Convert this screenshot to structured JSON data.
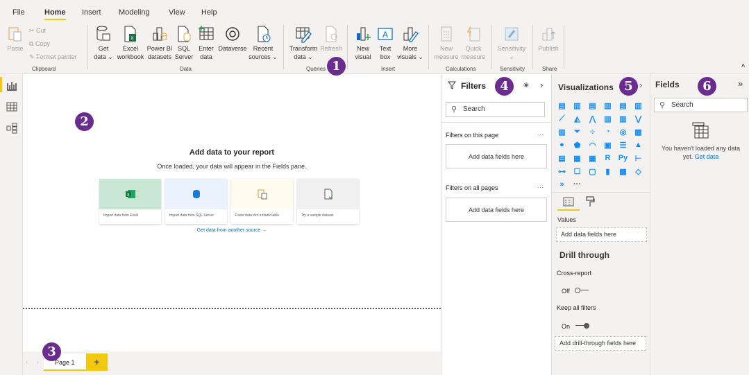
{
  "menu": {
    "tabs": [
      "File",
      "Home",
      "Insert",
      "Modeling",
      "View",
      "Help"
    ],
    "active": "Home"
  },
  "ribbon": {
    "clipboard": {
      "paste": "Paste",
      "cut": "Cut",
      "copy": "Copy",
      "format_painter": "Format painter",
      "group": "Clipboard"
    },
    "data": {
      "get_data": [
        "Get",
        "data ⌄"
      ],
      "excel": [
        "Excel",
        "workbook"
      ],
      "powerbi": [
        "Power BI",
        "datasets"
      ],
      "sql": [
        "SQL",
        "Server"
      ],
      "enter": [
        "Enter",
        "data"
      ],
      "dataverse": [
        "Dataverse",
        ""
      ],
      "recent": [
        "Recent",
        "sources ⌄"
      ],
      "group": "Data"
    },
    "queries": {
      "transform": [
        "Transform",
        "data ⌄"
      ],
      "refresh": [
        "Refresh",
        ""
      ],
      "group": "Queries"
    },
    "insert": {
      "new_visual": [
        "New",
        "visual"
      ],
      "text_box": [
        "Text",
        "box"
      ],
      "more_visuals": [
        "More",
        "visuals ⌄"
      ],
      "group": "Insert"
    },
    "calculations": {
      "new_measure": [
        "New",
        "measure"
      ],
      "quick_measure": [
        "Quick",
        "measure"
      ],
      "group": "Calculations"
    },
    "sensitivity": {
      "label": [
        "Sensitivity",
        "⌄"
      ],
      "group": "Sensitivity"
    },
    "share": {
      "publish": [
        "Publish",
        ""
      ],
      "group": "Share"
    },
    "collapse_icon": "^"
  },
  "badges": [
    "1",
    "2",
    "3",
    "4",
    "5",
    "6"
  ],
  "canvas": {
    "title": "Add data to your report",
    "subtitle": "Once loaded, your data will appear in the Fields pane.",
    "cards": [
      {
        "label": "Import data from Excel",
        "bg": "#c8e6d3"
      },
      {
        "label": "Import data from SQL Server",
        "bg": "#eaf2fc"
      },
      {
        "label": "Paste data into a blank table",
        "bg": "#fffbee"
      },
      {
        "label": "Try a sample dataset",
        "bg": "#f0f0f0"
      }
    ],
    "link": "Get data from another source →"
  },
  "pages": {
    "tabs": [
      "Page 1"
    ],
    "add": "+"
  },
  "filters": {
    "title": "Filters",
    "search_placeholder": "Search",
    "on_this_page": "Filters on this page",
    "on_all_pages": "Filters on all pages",
    "add_fields": "Add data fields here",
    "more": "···"
  },
  "visualizations": {
    "title": "Visualizations",
    "icons": [
      "▤",
      "▥",
      "▤",
      "▥",
      "▤",
      "▥",
      "⟋",
      "◭",
      "⋀",
      "▥",
      "▥",
      "⋁",
      "▥",
      "⏷",
      "⁘",
      "◔",
      "◎",
      "▦",
      "●",
      "⬟",
      "◠",
      "▣",
      "☰",
      "▲",
      "▤",
      "▦",
      "▦",
      "R",
      "Py",
      "⊢",
      "⊶",
      "☐",
      "▢",
      "▮",
      "▩",
      "◇",
      "»",
      "···"
    ],
    "values_label": "Values",
    "add_fields": "Add data fields here",
    "drill_title": "Drill through",
    "cross_report": "Cross-report",
    "cross_report_state": "Off",
    "keep_filters": "Keep all filters",
    "keep_filters_state": "On",
    "add_drill": "Add drill-through fields here"
  },
  "fields": {
    "title": "Fields",
    "search_placeholder": "Search",
    "empty_text": "You haven't loaded any data yet.",
    "get_data": "Get data"
  },
  "colors": {
    "accent": "#f2c811",
    "badge": "#6b2c8f",
    "link": "#0f6cbd"
  }
}
